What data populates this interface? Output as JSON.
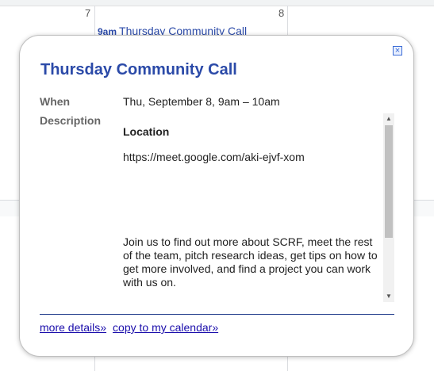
{
  "calendar": {
    "day_numbers": [
      "7",
      "8"
    ],
    "event": {
      "time": "9am",
      "title": "Thursday Community Call"
    }
  },
  "popup": {
    "close_label": "×",
    "title": "Thursday Community Call",
    "when_label": "When",
    "when_value": "Thu, September 8, 9am – 10am",
    "description_label": "Description",
    "description": {
      "location_heading": "Location",
      "location_url": "https://meet.google.com/aki-ejvf-xom",
      "body": "Join us to find out more about SCRF, meet the rest of the team, pitch research ideas, get tips on how to get more involved, and find a project you can work with us on."
    },
    "scroll": {
      "up_arrow": "▲",
      "down_arrow": "▼"
    },
    "links": {
      "more_details": "more details»",
      "copy_to_calendar": "copy to my calendar»"
    }
  }
}
